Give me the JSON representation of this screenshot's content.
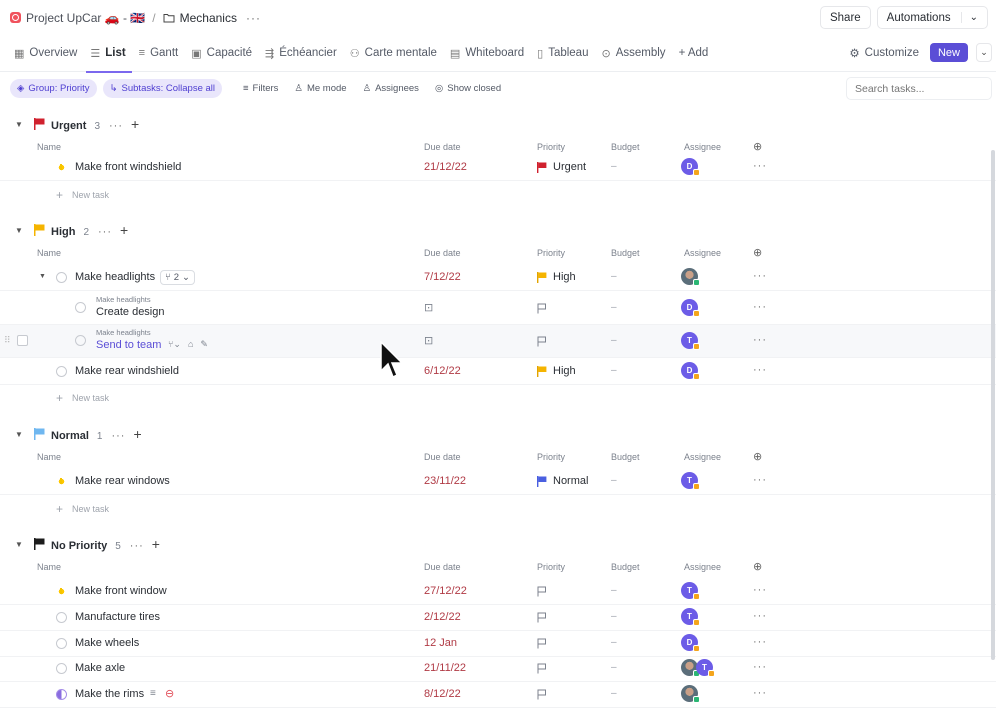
{
  "breadcrumb": {
    "space": "Project UpCar 🚗 - 🇬🇧",
    "folder": "Mechanics",
    "more": "···"
  },
  "top_actions": {
    "share": "Share",
    "automations": "Automations"
  },
  "tabs": [
    {
      "label": "Overview",
      "icon": "overview-icon"
    },
    {
      "label": "List",
      "icon": "list-icon",
      "active": true
    },
    {
      "label": "Gantt",
      "icon": "gantt-icon"
    },
    {
      "label": "Capacité",
      "icon": "capacity-icon"
    },
    {
      "label": "Échéancier",
      "icon": "timeline-icon"
    },
    {
      "label": "Carte mentale",
      "icon": "mindmap-icon"
    },
    {
      "label": "Whiteboard",
      "icon": "whiteboard-icon"
    },
    {
      "label": "Tableau",
      "icon": "table-icon"
    },
    {
      "label": "Assembly",
      "icon": "assembly-icon"
    },
    {
      "label": "+ Add",
      "icon": "plus-icon"
    }
  ],
  "tabs_right": {
    "customize": "Customize",
    "new": "New"
  },
  "filters": {
    "group": "Group: Priority",
    "subtasks": "Subtasks: Collapse all",
    "filters": "Filters",
    "me_mode": "Me mode",
    "assignees": "Assignees",
    "show_closed": "Show closed",
    "search_placeholder": "Search tasks..."
  },
  "columns": {
    "name": "Name",
    "due": "Due date",
    "priority": "Priority",
    "budget": "Budget",
    "assignee": "Assignee"
  },
  "new_task": "New task",
  "colors": {
    "urgent": "#d0212e",
    "high": "#f5b400",
    "normal": "#6fb7f0",
    "none": "#1c1c1c",
    "accent": "#5b4ed6"
  },
  "groups": {
    "urgent": {
      "name": "Urgent",
      "count": "3",
      "tasks": [
        {
          "name": "Make front windshield",
          "due": "21/12/22",
          "priority": "Urgent",
          "budget": "–",
          "assignee": "D"
        }
      ]
    },
    "high": {
      "name": "High",
      "count": "2",
      "tasks": [
        {
          "name": "Make headlights",
          "due": "7/12/22",
          "priority": "High",
          "budget": "–",
          "subtasks": "2"
        },
        {
          "name": "Make rear windshield",
          "due": "6/12/22",
          "priority": "High",
          "budget": "–",
          "assignee": "D"
        }
      ],
      "subtasks": [
        {
          "parent": "Make headlights",
          "name": "Create design",
          "budget": "–",
          "assignee": "D"
        },
        {
          "parent": "Make headlights",
          "name": "Send to team",
          "budget": "–",
          "assignee": "T"
        }
      ]
    },
    "normal": {
      "name": "Normal",
      "count": "1",
      "tasks": [
        {
          "name": "Make rear windows",
          "due": "23/11/22",
          "priority": "Normal",
          "budget": "–",
          "assignee": "T"
        }
      ]
    },
    "none": {
      "name": "No Priority",
      "count": "5",
      "tasks": [
        {
          "name": "Make front window",
          "due": "27/12/22",
          "budget": "–",
          "assignee": "T"
        },
        {
          "name": "Manufacture tires",
          "due": "2/12/22",
          "budget": "–",
          "assignee": "T"
        },
        {
          "name": "Make wheels",
          "due": "12 Jan",
          "budget": "–",
          "assignee": "D"
        },
        {
          "name": "Make axle",
          "due": "21/11/22",
          "budget": "–",
          "assignee": "T"
        },
        {
          "name": "Make the rims",
          "due": "8/12/22",
          "budget": "–"
        }
      ]
    }
  }
}
